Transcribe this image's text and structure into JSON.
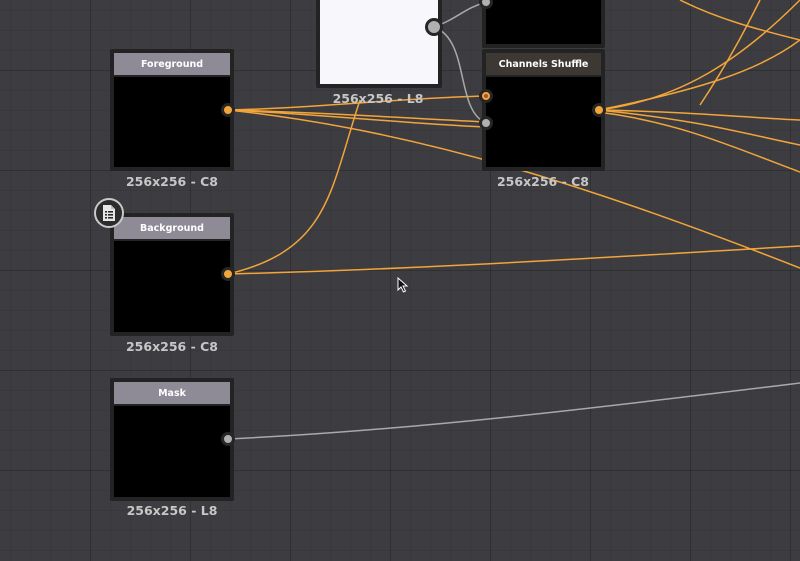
{
  "colors": {
    "canvas": "#3d3c40",
    "title_bar": "#8e8b97",
    "title_bar_active": "#3d3833",
    "orange_wire": "#f2a53a",
    "gray_wire": "#a9a9a9"
  },
  "nodes": {
    "foreground": {
      "title": "Foreground",
      "caption": "256x256 - C8"
    },
    "background": {
      "title": "Background",
      "caption": "256x256 - C8"
    },
    "mask": {
      "title": "Mask",
      "caption": "256x256 - L8"
    },
    "top_white": {
      "caption": "256x256 - L8"
    },
    "channels_shuffle": {
      "title": "Channels Shuffle",
      "caption": "256x256 - C8"
    }
  },
  "icons": {
    "doc_badge": "document-list-icon",
    "cursor": "mouse-pointer-icon"
  }
}
